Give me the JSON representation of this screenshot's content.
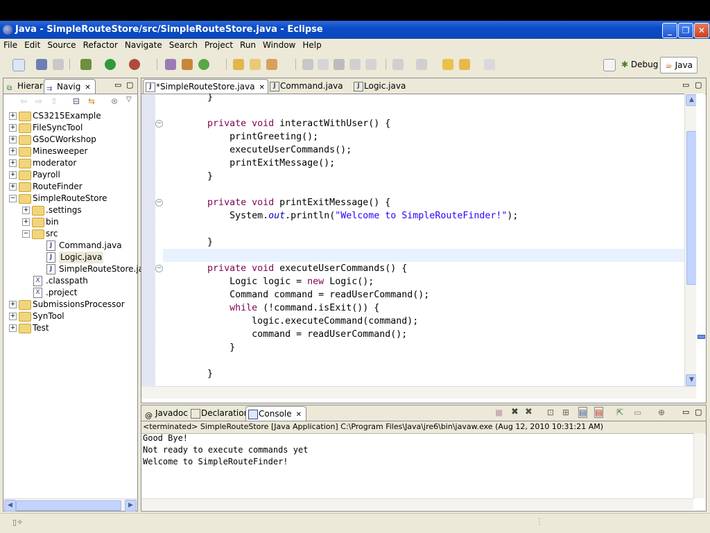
{
  "window": {
    "title": "Java - SimpleRouteStore/src/SimpleRouteStore.java - Eclipse"
  },
  "menu": [
    "File",
    "Edit",
    "Source",
    "Refactor",
    "Navigate",
    "Search",
    "Project",
    "Run",
    "Window",
    "Help"
  ],
  "perspectives": {
    "debug": "Debug",
    "java": "Java"
  },
  "navigator": {
    "tabs": {
      "hierarchy": "Hierar",
      "navigator": "Navig"
    },
    "tree": [
      {
        "label": "CS3215Example",
        "level": 0,
        "type": "folder",
        "expander": "+"
      },
      {
        "label": "FileSyncTool",
        "level": 0,
        "type": "folder",
        "expander": "+"
      },
      {
        "label": "GSoCWorkshop",
        "level": 0,
        "type": "folder",
        "expander": "+"
      },
      {
        "label": "Minesweeper",
        "level": 0,
        "type": "folder",
        "expander": "+"
      },
      {
        "label": "moderator",
        "level": 0,
        "type": "folder",
        "expander": "+"
      },
      {
        "label": "Payroll",
        "level": 0,
        "type": "folder",
        "expander": "+"
      },
      {
        "label": "RouteFinder",
        "level": 0,
        "type": "folder",
        "expander": "+"
      },
      {
        "label": "SimpleRouteStore",
        "level": 0,
        "type": "folder",
        "expander": "-"
      },
      {
        "label": ".settings",
        "level": 1,
        "type": "folder",
        "expander": "+"
      },
      {
        "label": "bin",
        "level": 1,
        "type": "folder",
        "expander": "+"
      },
      {
        "label": "src",
        "level": 1,
        "type": "folder",
        "expander": "-"
      },
      {
        "label": "Command.java",
        "level": 2,
        "type": "java",
        "expander": ""
      },
      {
        "label": "Logic.java",
        "level": 2,
        "type": "java",
        "expander": "",
        "selected": true
      },
      {
        "label": "SimpleRouteStore.java",
        "level": 2,
        "type": "java",
        "expander": ""
      },
      {
        "label": ".classpath",
        "level": 1,
        "type": "xml",
        "expander": ""
      },
      {
        "label": ".project",
        "level": 1,
        "type": "xml",
        "expander": ""
      },
      {
        "label": "SubmissionsProcessor",
        "level": 0,
        "type": "folder",
        "expander": "+"
      },
      {
        "label": "SynTool",
        "level": 0,
        "type": "folder",
        "expander": "+"
      },
      {
        "label": "Test",
        "level": 0,
        "type": "folder",
        "expander": "+"
      }
    ]
  },
  "editor": {
    "tabs": [
      {
        "label": "*SimpleRouteStore.java",
        "active": true
      },
      {
        "label": "Command.java",
        "active": false
      },
      {
        "label": "Logic.java",
        "active": false
      }
    ],
    "lines": [
      {
        "indent": "        ",
        "tokens": [
          {
            "t": "}",
            "c": ""
          }
        ]
      },
      {
        "indent": "",
        "tokens": []
      },
      {
        "indent": "        ",
        "tokens": [
          {
            "t": "private void ",
            "c": "kw"
          },
          {
            "t": "interactWithUser() {",
            "c": ""
          }
        ],
        "fold": true
      },
      {
        "indent": "            ",
        "tokens": [
          {
            "t": "printGreeting();",
            "c": ""
          }
        ]
      },
      {
        "indent": "            ",
        "tokens": [
          {
            "t": "executeUserCommands();",
            "c": ""
          }
        ]
      },
      {
        "indent": "            ",
        "tokens": [
          {
            "t": "printExitMessage();",
            "c": ""
          }
        ]
      },
      {
        "indent": "        ",
        "tokens": [
          {
            "t": "}",
            "c": ""
          }
        ]
      },
      {
        "indent": "",
        "tokens": []
      },
      {
        "indent": "        ",
        "tokens": [
          {
            "t": "private void ",
            "c": "kw"
          },
          {
            "t": "printExitMessage() {",
            "c": ""
          }
        ],
        "fold": true
      },
      {
        "indent": "            ",
        "tokens": [
          {
            "t": "System.",
            "c": ""
          },
          {
            "t": "out",
            "c": "fld"
          },
          {
            "t": ".println(",
            "c": ""
          },
          {
            "t": "\"Welcome to SimpleRouteFinder!\"",
            "c": "str"
          },
          {
            "t": ");",
            "c": ""
          }
        ]
      },
      {
        "indent": "",
        "tokens": []
      },
      {
        "indent": "        ",
        "tokens": [
          {
            "t": "}",
            "c": ""
          }
        ]
      },
      {
        "indent": "",
        "tokens": [],
        "current": true
      },
      {
        "indent": "        ",
        "tokens": [
          {
            "t": "private void ",
            "c": "kw"
          },
          {
            "t": "executeUserCommands() {",
            "c": ""
          }
        ],
        "fold": true
      },
      {
        "indent": "            ",
        "tokens": [
          {
            "t": "Logic logic = ",
            "c": ""
          },
          {
            "t": "new ",
            "c": "kw"
          },
          {
            "t": "Logic();",
            "c": ""
          }
        ]
      },
      {
        "indent": "            ",
        "tokens": [
          {
            "t": "Command command = readUserCommand();",
            "c": ""
          }
        ]
      },
      {
        "indent": "            ",
        "tokens": [
          {
            "t": "while ",
            "c": "kw"
          },
          {
            "t": "(!command.isExit()) {",
            "c": ""
          }
        ]
      },
      {
        "indent": "                ",
        "tokens": [
          {
            "t": "logic.executeCommand(command);",
            "c": ""
          }
        ]
      },
      {
        "indent": "                ",
        "tokens": [
          {
            "t": "command = readUserCommand();",
            "c": ""
          }
        ]
      },
      {
        "indent": "            ",
        "tokens": [
          {
            "t": "}",
            "c": ""
          }
        ]
      },
      {
        "indent": "",
        "tokens": []
      },
      {
        "indent": "        ",
        "tokens": [
          {
            "t": "}",
            "c": ""
          }
        ]
      }
    ]
  },
  "console": {
    "tabs": [
      {
        "label": "Javadoc",
        "active": false
      },
      {
        "label": "Declaration",
        "active": false
      },
      {
        "label": "Console",
        "active": true
      }
    ],
    "header": "<terminated> SimpleRouteStore [Java Application] C:\\Program Files\\Java\\jre6\\bin\\javaw.exe (Aug 12, 2010 10:31:21 AM)",
    "output": [
      "Good Bye!",
      "Not ready to execute commands yet",
      "Welcome to SimpleRouteFinder!"
    ]
  },
  "icons": {
    "app": "eclipse-icon",
    "folder": "folder-icon",
    "java_file": "java-file-icon",
    "xml_file": "xml-file-icon"
  },
  "colors": {
    "keyword": "#7f0055",
    "string": "#2a00ff",
    "field": "#0000c0",
    "title_bar": "#0a4bc8",
    "chrome": "#ece9d8"
  }
}
